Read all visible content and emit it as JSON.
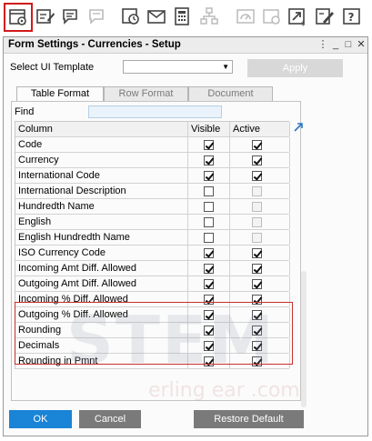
{
  "toolbar": {
    "icons": [
      "form-settings-icon",
      "edit-form-icon",
      "messages-icon",
      "chat-icon",
      "timer-alert-icon",
      "mail-icon",
      "calculator-icon",
      "network-icon",
      "speedometer-settings-icon",
      "export-icon",
      "edit-document-icon",
      "help-icon"
    ]
  },
  "window": {
    "title": "Form Settings - Currencies - Setup",
    "controls": {
      "menu": "⋮",
      "minimize": "_",
      "maximize": "□",
      "close": "✕"
    }
  },
  "template": {
    "label": "Select UI Template",
    "value": "",
    "apply_label": "Apply"
  },
  "tabs": [
    {
      "label": "Table Format",
      "active": true
    },
    {
      "label": "Row Format",
      "active": false
    },
    {
      "label": "Document",
      "active": false
    }
  ],
  "find": {
    "label": "Find",
    "value": ""
  },
  "grid": {
    "headers": {
      "column": "Column",
      "visible": "Visible",
      "active": "Active"
    },
    "rows": [
      {
        "name": "Code",
        "visible": true,
        "active": true,
        "visible_enabled": true,
        "active_enabled": true
      },
      {
        "name": "Currency",
        "visible": true,
        "active": true,
        "visible_enabled": true,
        "active_enabled": true
      },
      {
        "name": "International Code",
        "visible": true,
        "active": true,
        "visible_enabled": true,
        "active_enabled": true
      },
      {
        "name": "International Description",
        "visible": false,
        "active": false,
        "visible_enabled": true,
        "active_enabled": false
      },
      {
        "name": "Hundredth Name",
        "visible": false,
        "active": false,
        "visible_enabled": true,
        "active_enabled": false
      },
      {
        "name": "English",
        "visible": false,
        "active": false,
        "visible_enabled": true,
        "active_enabled": false
      },
      {
        "name": "English Hundredth Name",
        "visible": false,
        "active": false,
        "visible_enabled": true,
        "active_enabled": false
      },
      {
        "name": "ISO Currency Code",
        "visible": true,
        "active": true,
        "visible_enabled": true,
        "active_enabled": true
      },
      {
        "name": "Incoming Amt Diff. Allowed",
        "visible": true,
        "active": true,
        "visible_enabled": true,
        "active_enabled": true
      },
      {
        "name": "Outgoing Amt Diff. Allowed",
        "visible": true,
        "active": true,
        "visible_enabled": true,
        "active_enabled": true
      },
      {
        "name": "Incoming % Diff. Allowed",
        "visible": true,
        "active": true,
        "visible_enabled": true,
        "active_enabled": true
      },
      {
        "name": "Outgoing % Diff. Allowed",
        "visible": true,
        "active": true,
        "visible_enabled": true,
        "active_enabled": true
      },
      {
        "name": "Rounding",
        "visible": true,
        "active": true,
        "visible_enabled": true,
        "active_enabled": true
      },
      {
        "name": "Decimals",
        "visible": true,
        "active": true,
        "visible_enabled": true,
        "active_enabled": true
      },
      {
        "name": "Rounding in Pmnt",
        "visible": true,
        "active": true,
        "visible_enabled": true,
        "active_enabled": true
      }
    ]
  },
  "watermark": {
    "main": "STEM",
    "sub": "erling ear .com"
  },
  "buttons": {
    "ok": "OK",
    "cancel": "Cancel",
    "restore": "Restore Default"
  },
  "colors": {
    "ok": "#1a84d6",
    "secondary": "#7a7a7a",
    "highlight": "#c63030"
  }
}
